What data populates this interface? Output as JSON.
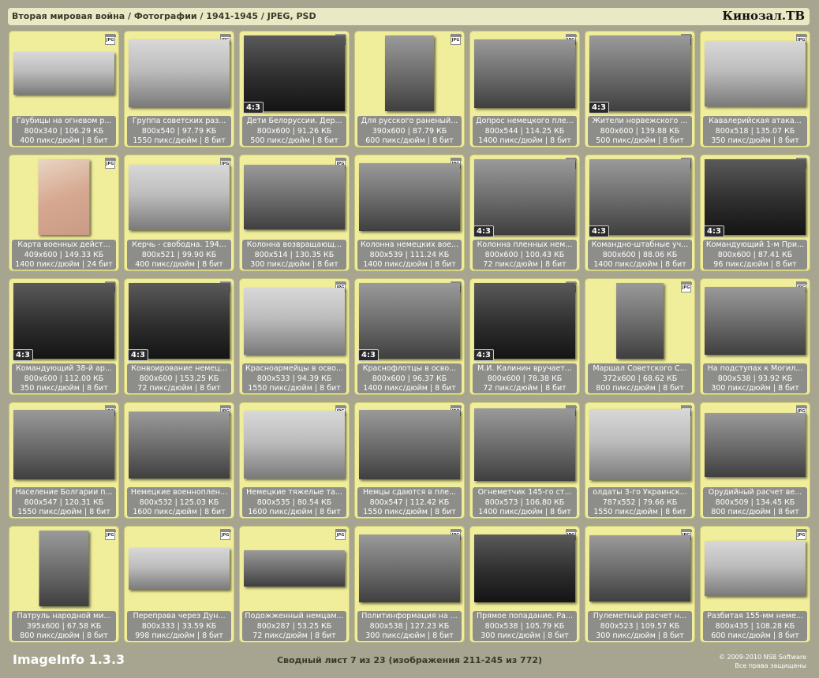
{
  "header": {
    "path": "Вторая мировая война / Фотографии / 1941-1945 / JPEG, PSD",
    "brand": "Кинозал.ТВ"
  },
  "icons": {
    "file_type": "jpg-file-icon",
    "file_type_label": "JPG"
  },
  "tiles": [
    {
      "title": "Гаубицы на огневом р...",
      "dims": "800x340 | 106.29 КБ",
      "res": "400 пикс/дюйм | 8 бит",
      "ratio": "",
      "tone": "light"
    },
    {
      "title": "Группа советских раз...",
      "dims": "800x540 | 97.79 КБ",
      "res": "1550 пикс/дюйм | 8 бит",
      "ratio": "",
      "tone": "light"
    },
    {
      "title": "Дети Белоруссии. Дер...",
      "dims": "800x600 | 91.26 КБ",
      "res": "500 пикс/дюйм | 8 бит",
      "ratio": "4:3",
      "tone": "dark"
    },
    {
      "title": "Для русского раненый...",
      "dims": "390x600 | 87.79 КБ",
      "res": "600 пикс/дюйм | 8 бит",
      "ratio": "",
      "tone": "mid"
    },
    {
      "title": "Допрос немецкого пле...",
      "dims": "800x544 | 114.25 КБ",
      "res": "1400 пикс/дюйм | 8 бит",
      "ratio": "",
      "tone": "mid"
    },
    {
      "title": "Жители норвежского ...",
      "dims": "800x600 | 139.88 КБ",
      "res": "500 пикс/дюйм | 8 бит",
      "ratio": "4:3",
      "tone": "mid"
    },
    {
      "title": "Кавалерийская атака...",
      "dims": "800x518 | 135.07 КБ",
      "res": "350 пикс/дюйм | 8 бит",
      "ratio": "",
      "tone": "light"
    },
    {
      "title": "Карта военных дейст...",
      "dims": "409x600 | 149.33 КБ",
      "res": "1400 пикс/дюйм | 24 бит",
      "ratio": "",
      "tone": "map"
    },
    {
      "title": "Керчь - свободна. 194...",
      "dims": "800x521 | 99.90 КБ",
      "res": "400 пикс/дюйм | 8 бит",
      "ratio": "",
      "tone": "light"
    },
    {
      "title": "Колонна возвращающ...",
      "dims": "800x514 | 130.35 КБ",
      "res": "300 пикс/дюйм | 8 бит",
      "ratio": "",
      "tone": "mid"
    },
    {
      "title": "Колонна немецких вое...",
      "dims": "800x539 | 111.24 КБ",
      "res": "1400 пикс/дюйм | 8 бит",
      "ratio": "",
      "tone": "mid"
    },
    {
      "title": "Колонна пленных нем...",
      "dims": "800x600 | 100.43 КБ",
      "res": "72 пикс/дюйм | 8 бит",
      "ratio": "4:3",
      "tone": "mid"
    },
    {
      "title": "Командно-штабные уч...",
      "dims": "800x600 | 88.06 КБ",
      "res": "1400 пикс/дюйм | 8 бит",
      "ratio": "4:3",
      "tone": "mid"
    },
    {
      "title": "Командующий 1-м При...",
      "dims": "800x600 | 87.41 КБ",
      "res": "96 пикс/дюйм | 8 бит",
      "ratio": "4:3",
      "tone": "dark"
    },
    {
      "title": "Командующий 38-й ар...",
      "dims": "800x600 | 112.00 КБ",
      "res": "350 пикс/дюйм | 8 бит",
      "ratio": "4:3",
      "tone": "dark"
    },
    {
      "title": "Конвоирование немец...",
      "dims": "800x600 | 153.25 КБ",
      "res": "72 пикс/дюйм | 8 бит",
      "ratio": "4:3",
      "tone": "dark"
    },
    {
      "title": "Красноармейцы в осво...",
      "dims": "800x533 | 94.39 КБ",
      "res": "1550 пикс/дюйм | 8 бит",
      "ratio": "",
      "tone": "light"
    },
    {
      "title": "Краснофлотцы в осво...",
      "dims": "800x600 | 96.37 КБ",
      "res": "1400 пикс/дюйм | 8 бит",
      "ratio": "4:3",
      "tone": "mid"
    },
    {
      "title": "М.И. Калинин вручает...",
      "dims": "800x600 | 78.38 КБ",
      "res": "72 пикс/дюйм | 8 бит",
      "ratio": "4:3",
      "tone": "dark"
    },
    {
      "title": "Маршал Советского С...",
      "dims": "372x600 | 68.62 КБ",
      "res": "800 пикс/дюйм | 8 бит",
      "ratio": "",
      "tone": "mid"
    },
    {
      "title": "На подступах к Могил...",
      "dims": "800x538 | 93.92 КБ",
      "res": "300 пикс/дюйм | 8 бит",
      "ratio": "",
      "tone": "mid"
    },
    {
      "title": "Население Болгарии п...",
      "dims": "800x547 | 120.31 КБ",
      "res": "1550 пикс/дюйм | 8 бит",
      "ratio": "",
      "tone": "mid"
    },
    {
      "title": "Немецкие военноплен...",
      "dims": "800x532 | 125.03 КБ",
      "res": "1600 пикс/дюйм | 8 бит",
      "ratio": "",
      "tone": "mid"
    },
    {
      "title": "Немецкие тяжелые та...",
      "dims": "800x535 | 80.54 КБ",
      "res": "1600 пикс/дюйм | 8 бит",
      "ratio": "",
      "tone": "light"
    },
    {
      "title": "Немцы сдаются в пле...",
      "dims": "800x547 | 112.42 КБ",
      "res": "1550 пикс/дюйм | 8 бит",
      "ratio": "",
      "tone": "mid"
    },
    {
      "title": "Огнеметчик 145-го ст...",
      "dims": "800x573 | 106.80 КБ",
      "res": "1400 пикс/дюйм | 8 бит",
      "ratio": "",
      "tone": "mid"
    },
    {
      "title": "олдаты 3-го Украинск...",
      "dims": "787x552 | 79.66 КБ",
      "res": "1550 пикс/дюйм | 8 бит",
      "ratio": "",
      "tone": "light"
    },
    {
      "title": "Орудийный расчет ве...",
      "dims": "800x509 | 134.45 КБ",
      "res": "800 пикс/дюйм | 8 бит",
      "ratio": "",
      "tone": "mid"
    },
    {
      "title": "Патруль народной ми...",
      "dims": "395x600 | 67.58 КБ",
      "res": "800 пикс/дюйм | 8 бит",
      "ratio": "",
      "tone": "mid"
    },
    {
      "title": "Переправа через Дун...",
      "dims": "800x333 | 33.59 КБ",
      "res": "998 пикс/дюйм | 8 бит",
      "ratio": "",
      "tone": "light"
    },
    {
      "title": "Подожженный немцам...",
      "dims": "800x287 | 53.25 КБ",
      "res": "72 пикс/дюйм | 8 бит",
      "ratio": "",
      "tone": "mid"
    },
    {
      "title": "Политинформация на ...",
      "dims": "800x538 | 127.23 КБ",
      "res": "300 пикс/дюйм | 8 бит",
      "ratio": "",
      "tone": "mid"
    },
    {
      "title": "Прямое попадание. Ра...",
      "dims": "800x538 | 105.79 КБ",
      "res": "300 пикс/дюйм | 8 бит",
      "ratio": "",
      "tone": "dark"
    },
    {
      "title": "Пулеметный расчет н...",
      "dims": "800x523 | 109.57 КБ",
      "res": "300 пикс/дюйм | 8 бит",
      "ratio": "",
      "tone": "mid"
    },
    {
      "title": "Разбитая 155-мм неме...",
      "dims": "800x435 | 108.28 КБ",
      "res": "600 пикс/дюйм | 8 бит",
      "ratio": "",
      "tone": "light"
    }
  ],
  "footer": {
    "app": "ImageInfo 1.3.3",
    "summary": "Сводный лист 7 из 23 (изображения 211-245 из 772)",
    "copyright": "© 2009-2010 NSB Software",
    "rights": "Все права защищены"
  }
}
